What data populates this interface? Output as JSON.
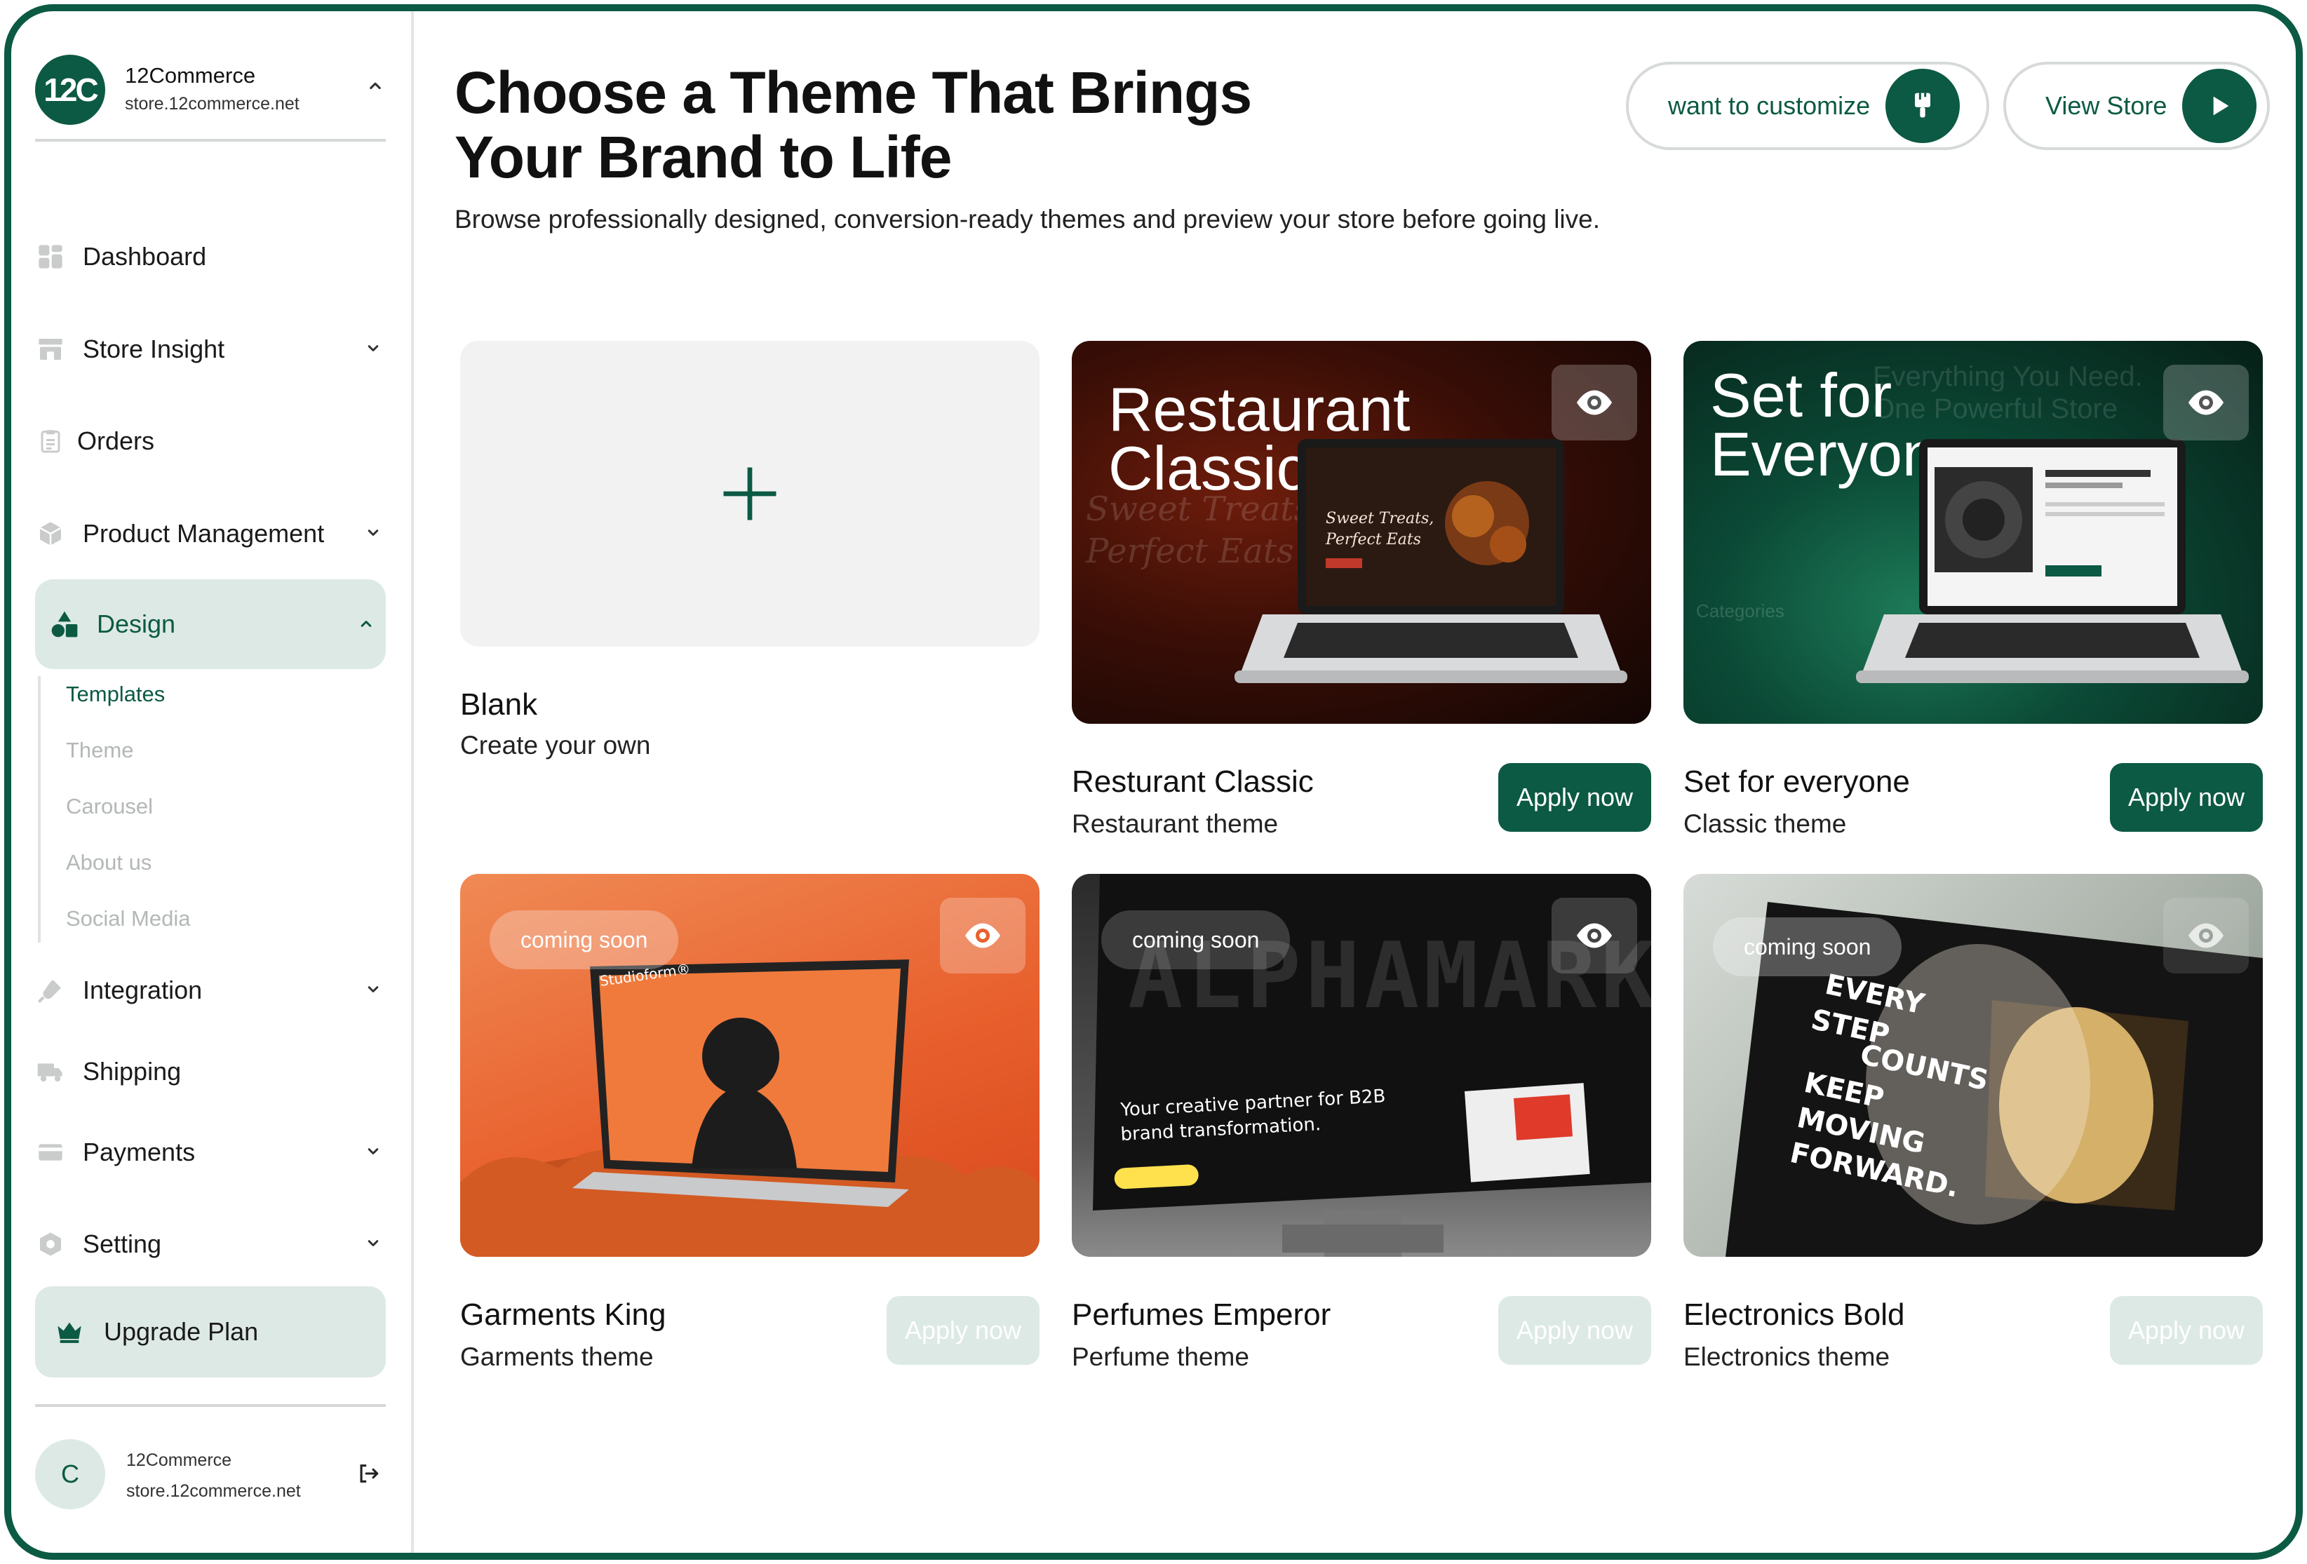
{
  "sidebar": {
    "brand": {
      "logo": "12C",
      "name": "12Commerce",
      "url": "store.12commerce.net"
    },
    "items": [
      {
        "label": "Dashboard",
        "icon": "dashboard-icon"
      },
      {
        "label": "Store Insight",
        "icon": "store-icon"
      },
      {
        "label": "Orders",
        "icon": "clipboard-icon"
      },
      {
        "label": "Product Management",
        "icon": "box-icon"
      },
      {
        "label": "Design",
        "icon": "shapes-icon"
      },
      {
        "label": "Integration",
        "icon": "plug-icon"
      },
      {
        "label": "Shipping",
        "icon": "truck-icon"
      },
      {
        "label": "Payments",
        "icon": "card-icon"
      },
      {
        "label": "Setting",
        "icon": "hexagon-icon"
      }
    ],
    "design_subitems": [
      "Templates",
      "Theme",
      "Carousel",
      "About us",
      "Social Media"
    ],
    "upgrade": {
      "label": "Upgrade Plan",
      "icon": "crown-icon"
    },
    "user": {
      "avatar": "C",
      "name": "12Commerce",
      "url": "store.12commerce.net"
    }
  },
  "header": {
    "title_line1": "Choose a Theme That Brings",
    "title_line2": "Your Brand to Life",
    "subtitle": "Browse professionally designed, conversion-ready themes and preview your store before going live.",
    "customize_label": "want to customize",
    "view_store_label": "View Store"
  },
  "cards": {
    "blank": {
      "name": "Blank",
      "desc": "Create your own"
    },
    "restaurant": {
      "name": "Resturant Classic",
      "desc": "Restaurant theme",
      "hero": "Restaurant Classic",
      "apply": "Apply now",
      "hero_l1": "Restaurant",
      "hero_l2": "Classic",
      "bg_tagline": "Sweet Treats, Perfect Eats"
    },
    "everyone": {
      "name": "Set for everyone",
      "desc": "Classic theme",
      "apply": "Apply now",
      "hero_l1": "Set for",
      "hero_l2": "Everyone",
      "bg_text": "Everything You Need. One Powerful Store",
      "bg_sub": "Categories"
    },
    "garments": {
      "name": "Garments King",
      "desc": "Garments theme",
      "apply": "Apply now",
      "badge": "coming soon",
      "screen_brand": "Studioform®"
    },
    "perfumes": {
      "name": "Perfumes Emperor",
      "desc": "Perfume theme",
      "apply": "Apply now",
      "badge": "coming soon",
      "screen_head": "ALPHAMARK",
      "screen_line1": "Your creative partner for B2B",
      "screen_line2": "brand transformation."
    },
    "electronics": {
      "name": "Electronics Bold",
      "desc": "Electronics theme",
      "apply": "Apply now",
      "badge": "coming soon",
      "screen_lines": [
        "EVERY",
        "STEP",
        "COUNTS",
        "KEEP",
        "MOVING",
        "FORWARD."
      ]
    }
  },
  "colors": {
    "brand": "#0c5a43",
    "active_bg": "#dde9e5",
    "disabled_text": "#b3b8b6"
  }
}
